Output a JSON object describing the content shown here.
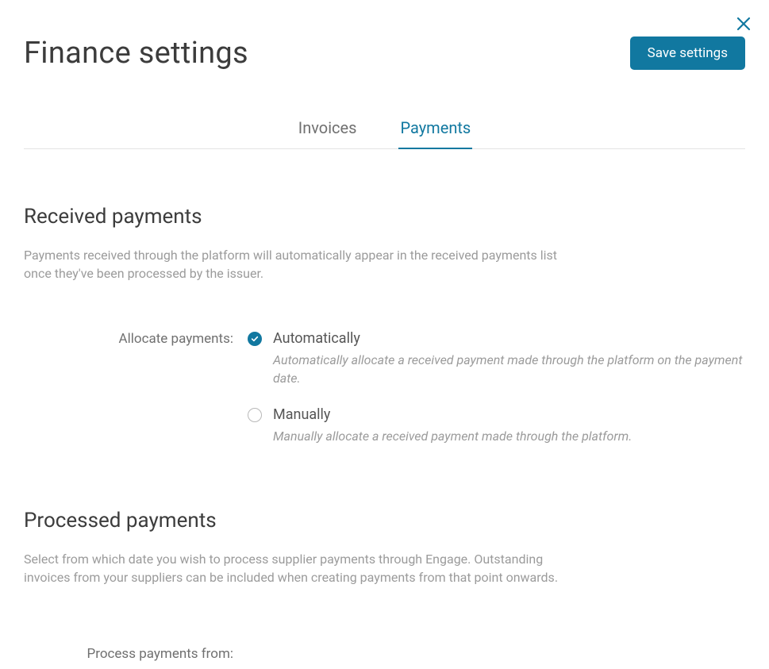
{
  "close": {},
  "header": {
    "title": "Finance settings",
    "save_label": "Save settings"
  },
  "tabs": [
    {
      "label": "Invoices",
      "active": false
    },
    {
      "label": "Payments",
      "active": true
    }
  ],
  "received": {
    "title": "Received payments",
    "description": "Payments received through the platform will automatically appear in the received payments list once they've been processed by the issuer.",
    "allocate_label": "Allocate payments:",
    "options": [
      {
        "label": "Automatically",
        "description": "Automatically allocate a received payment made through the platform on the payment date.",
        "selected": true
      },
      {
        "label": "Manually",
        "description": "Manually allocate a received payment made through the platform.",
        "selected": false
      }
    ]
  },
  "processed": {
    "title": "Processed payments",
    "description": "Select from which date you wish to process supplier payments through Engage. Outstanding invoices from your suppliers can be included when creating payments from that point onwards.",
    "process_from_label": "Process payments from:"
  }
}
